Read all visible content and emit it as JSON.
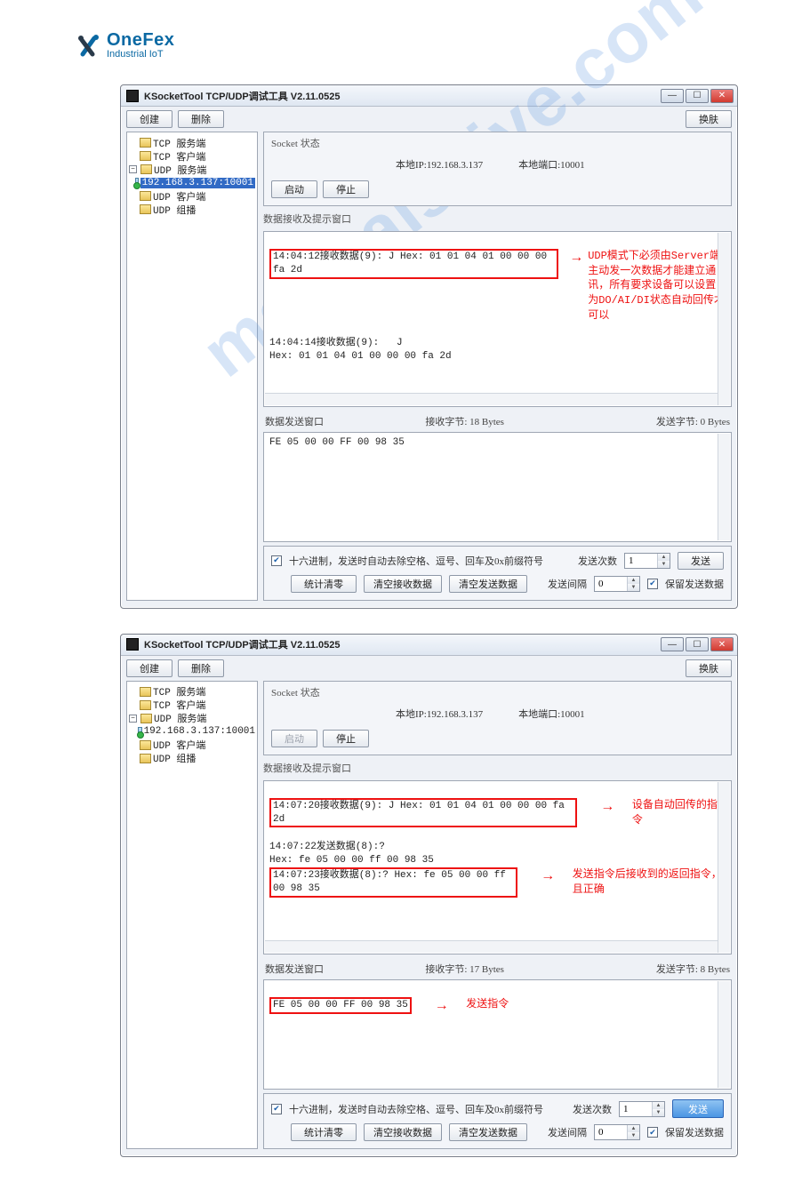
{
  "logo": {
    "line1": "OneFex",
    "line2": "Industrial IoT"
  },
  "watermark": "manualshive.com",
  "win1": {
    "title": "KSocketTool TCP/UDP调试工具 V2.11.0525",
    "btn_create": "创建",
    "btn_delete": "删除",
    "btn_switch": "换肤",
    "tree": {
      "items": [
        {
          "label": "TCP 服务端",
          "icon": "folder"
        },
        {
          "label": "TCP 客户端",
          "icon": "folder"
        },
        {
          "label": "UDP 服务端",
          "icon": "folder",
          "open": true,
          "children": [
            {
              "label": "192.168.3.137:10001",
              "icon": "pc",
              "selected": true
            }
          ]
        },
        {
          "label": "UDP 客户端",
          "icon": "folder"
        },
        {
          "label": "UDP 组播",
          "icon": "folder"
        }
      ]
    },
    "status": {
      "title": "Socket 状态",
      "ip_label": "本地IP:",
      "ip": "192.168.3.137",
      "port_label": "本地端口:",
      "port": "10001",
      "btn_start": "启动",
      "btn_stop": "停止"
    },
    "recv": {
      "header": "数据接收及提示窗口",
      "line1a": "14:04:12接收数据(9):   J",
      "line1b": "Hex: 01 01 04 01 00 00 00 fa 2d",
      "line2a": "14:04:14接收数据(9):   J",
      "line2b": "Hex: 01 01 04 01 00 00 00 fa 2d",
      "annot": "UDP模式下必须由Server端主动发一次数据才能建立通讯，所有要求设备可以设置为DO/AI/DI状态自动回传才可以"
    },
    "mid": {
      "c1": "数据发送窗口",
      "c2": "接收字节: 18 Bytes",
      "c3": "发送字节: 0 Bytes"
    },
    "send": {
      "content": "FE 05 00 00 FF 00 98 35"
    },
    "bottom": {
      "opt1": "十六进制，发送时自动去除空格、逗号、回车及0x前缀符号",
      "send_count": "发送次数",
      "send_count_val": "1",
      "btn_send": "发送",
      "btn_stat_clear": "统计清零",
      "btn_recv_clear": "清空接收数据",
      "btn_send_clear": "清空发送数据",
      "send_interval": "发送间隔",
      "send_interval_val": "0",
      "opt2": "保留发送数据"
    }
  },
  "win2": {
    "title": "KSocketTool TCP/UDP调试工具 V2.11.0525",
    "btn_create": "创建",
    "btn_delete": "删除",
    "btn_switch": "换肤",
    "tree": {
      "items": [
        {
          "label": "TCP 服务端",
          "icon": "folder"
        },
        {
          "label": "TCP 客户端",
          "icon": "folder"
        },
        {
          "label": "UDP 服务端",
          "icon": "folder",
          "open": true,
          "children": [
            {
              "label": "192.168.3.137:10001",
              "icon": "pc"
            }
          ]
        },
        {
          "label": "UDP 客户端",
          "icon": "folder"
        },
        {
          "label": "UDP 组播",
          "icon": "folder"
        }
      ]
    },
    "status": {
      "title": "Socket 状态",
      "ip_label": "本地IP:",
      "ip": "192.168.3.137",
      "port_label": "本地端口:",
      "port": "10001",
      "btn_start": "启动",
      "btn_stop": "停止"
    },
    "recv": {
      "header": "数据接收及提示窗口",
      "line1a": "14:07:20接收数据(9):   J",
      "line1b": "Hex: 01 01 04 01 00 00 00 fa 2d",
      "annot1": "设备自动回传的指令",
      "line2a": "14:07:22发送数据(8):?",
      "line2b": "Hex: fe 05 00 00 ff 00 98 35",
      "line3a": "14:07:23接收数据(8):?",
      "line3b": "Hex: fe 05 00 00 ff 00 98 35",
      "annot2": "发送指令后接收到的返回指令，且正确"
    },
    "mid": {
      "c1": "数据发送窗口",
      "c2": "接收字节: 17 Bytes",
      "c3": "发送字节: 8 Bytes"
    },
    "send": {
      "content": "FE 05 00 00 FF 00 98 35",
      "annot": "发送指令"
    },
    "bottom": {
      "opt1": "十六进制，发送时自动去除空格、逗号、回车及0x前缀符号",
      "send_count": "发送次数",
      "send_count_val": "1",
      "btn_send": "发送",
      "btn_stat_clear": "统计清零",
      "btn_recv_clear": "清空接收数据",
      "btn_send_clear": "清空发送数据",
      "send_interval": "发送间隔",
      "send_interval_val": "0",
      "opt2": "保留发送数据"
    }
  }
}
